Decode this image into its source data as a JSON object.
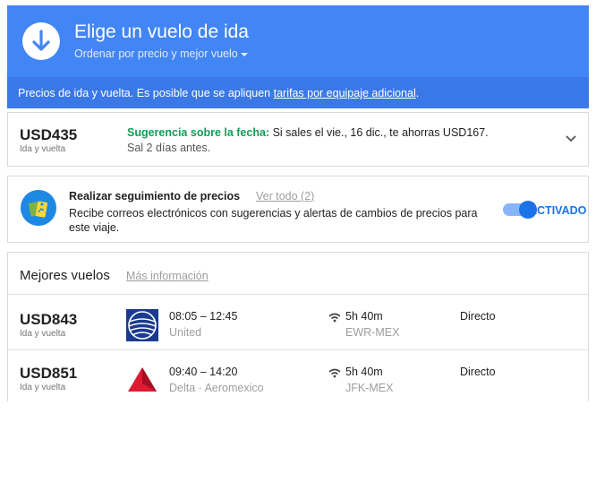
{
  "header": {
    "title": "Elige un vuelo de ida",
    "sort_label": "Ordenar por precio y mejor vuelo"
  },
  "notice": {
    "text": "Precios de ida y vuelta. Es posible que se apliquen ",
    "link": "tarifas por equipaje adicional",
    "suffix": "."
  },
  "suggestion": {
    "price": "USD435",
    "price_sub": "Ida y vuelta",
    "heading": "Sugerencia sobre la fecha:",
    "text": " Si sales el vie., 16 dic., te ahorras USD167.",
    "line2": "Sal 2 días antes."
  },
  "tracking": {
    "title": "Realizar seguimiento de precios",
    "link": "Ver todo (2)",
    "description": "Recibe correos electrónicos con sugerencias y alertas de cambios de precios para este viaje.",
    "toggle_label": "ACTIVADO",
    "toggle_on": true
  },
  "best": {
    "title": "Mejores vuelos",
    "link": "Más información",
    "flights": [
      {
        "price": "USD843",
        "price_sub": "Ida y vuelta",
        "logo": "united-logo-icon",
        "times": "08:05 – 12:45",
        "airline": "United",
        "duration": "5h 40m",
        "route": "EWR-MEX",
        "stops": "Directo"
      },
      {
        "price": "USD851",
        "price_sub": "Ida y vuelta",
        "logo": "delta-logo-icon",
        "times": "09:40 – 14:20",
        "airline": "Delta · Aeromexico",
        "duration": "5h 40m",
        "route": "JFK-MEX",
        "stops": "Directo"
      }
    ]
  },
  "colors": {
    "header_bg": "#4285f4",
    "notice_bg": "#3b78e7",
    "suggestion_green": "#0f9d58",
    "toggle_blue": "#1a73e8"
  }
}
